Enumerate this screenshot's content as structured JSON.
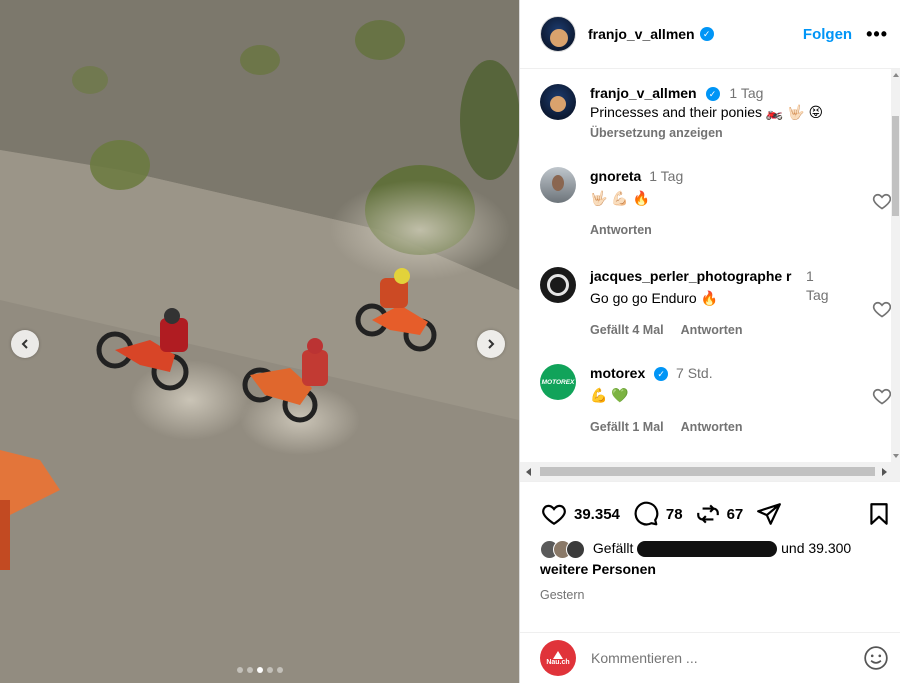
{
  "post": {
    "author": "franjo_v_allmen",
    "follow_label": "Folgen",
    "more_label": "•••",
    "caption": {
      "user": "franjo_v_allmen",
      "time": "1 Tag",
      "text": "Princesses and their ponies 🏍️ 🤟🏻 😝",
      "translate_label": "Übersetzung anzeigen"
    },
    "comments": [
      {
        "user": "gnoreta",
        "time": "1 Tag",
        "text": "🤟🏻 💪🏻 🔥",
        "likes_label": "",
        "reply_label": "Antworten"
      },
      {
        "user": "jacques_perler_photographe r",
        "time": "1 Tag",
        "text": "Go go go Enduro 🔥",
        "likes_label": "Gefällt 4 Mal",
        "reply_label": "Antworten"
      },
      {
        "user": "motorex",
        "time": "7 Std.",
        "text": "💪 💚",
        "likes_label": "Gefällt 1 Mal",
        "reply_label": "Antworten"
      }
    ],
    "stats": {
      "likes": "39.354",
      "comments": "78",
      "reposts": "67"
    },
    "liked_by": {
      "prefix": "Gefällt",
      "suffix": "und 39.300",
      "suffix2": "weitere Personen"
    },
    "date": "Gestern",
    "comment_placeholder": "Kommentieren ...",
    "commenter_logo_text": "Nau.ch"
  },
  "carousel": {
    "slides": 5,
    "active": 2
  },
  "colors": {
    "accent": "#0095f6",
    "muted": "#737373",
    "border": "#dbdbdb"
  }
}
